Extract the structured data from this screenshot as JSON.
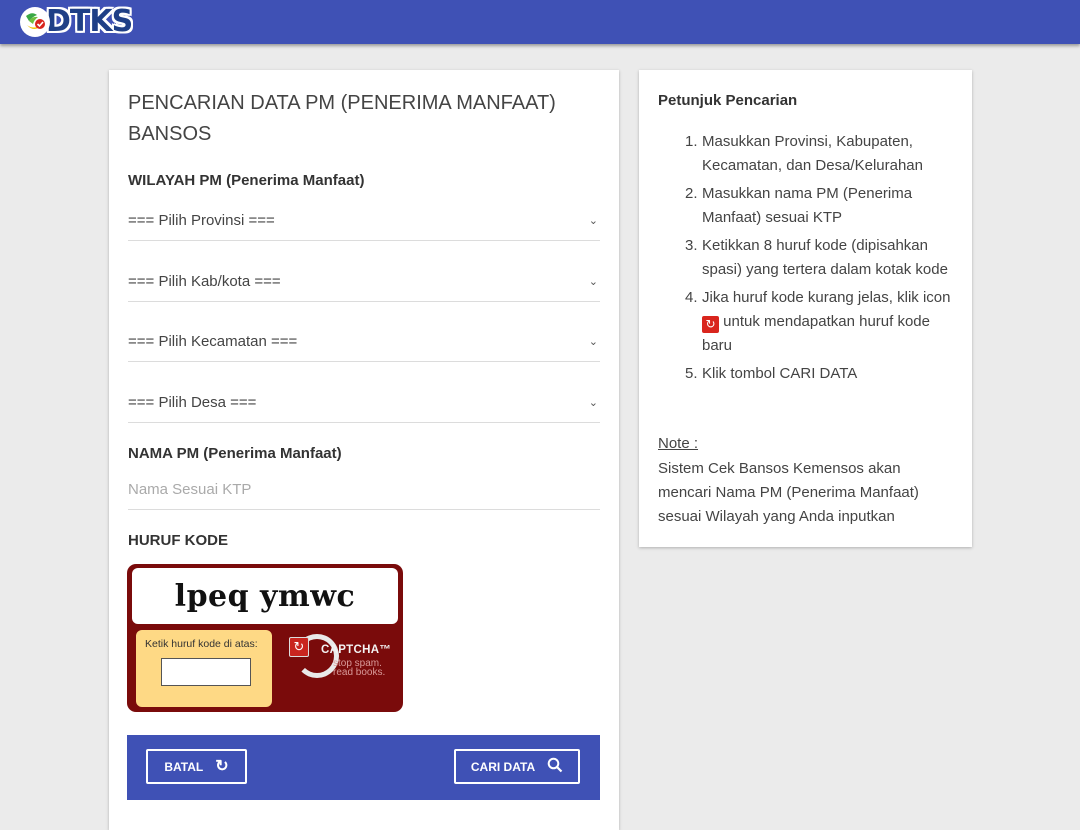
{
  "header": {
    "logo_text": "DTKS",
    "bar_color": "#3f51b5"
  },
  "form": {
    "title": "PENCARIAN DATA PM (PENERIMA MANFAAT) BANSOS",
    "region_label": "WILAYAH PM (Penerima Manfaat)",
    "selects": [
      {
        "label": "=== Pilih Provinsi ===",
        "icon": "chevron-down-icon"
      },
      {
        "label": "=== Pilih Kab/kota ===",
        "icon": "chevron-down-icon"
      },
      {
        "label": "=== Pilih Kecamatan ===",
        "icon": "chevron-down-icon"
      },
      {
        "label": "=== Pilih Desa ===",
        "icon": "chevron-down-icon"
      }
    ],
    "name_label": "NAMA PM (Penerima Manfaat)",
    "name_placeholder": "Nama Sesuai KTP",
    "name_value": "",
    "code_label": "HURUF KODE",
    "captcha": {
      "challenge": "lpeq ymwc",
      "entry_label": "Ketik huruf kode di atas:",
      "entry_value": "",
      "brand": "CAPTCHA™",
      "tagline_1": "stop spam.",
      "tagline_2": "read books."
    },
    "buttons": {
      "cancel": "BATAL",
      "search": "CARI DATA"
    }
  },
  "help": {
    "title": "Petunjuk Pencarian",
    "steps": [
      {
        "num": "1.",
        "text": "Masukkan Provinsi, Kabupaten, Kecamatan, dan Desa/Kelurahan"
      },
      {
        "num": "2.",
        "text": "Masukkan nama PM (Penerima Manfaat) sesuai KTP"
      },
      {
        "num": "3.",
        "text": "Ketikkan 8 huruf kode (dipisahkan spasi) yang tertera dalam kotak kode"
      },
      {
        "num": "4.",
        "text_before": "Jika huruf kode kurang jelas, klik icon",
        "text_after": "untuk mendapatkan huruf kode baru"
      },
      {
        "num": "5.",
        "text": "Klik tombol CARI DATA"
      }
    ],
    "note_title": "Note :",
    "note_text": "Sistem Cek Bansos Kemensos akan mencari Nama PM (Penerima Manfaat) sesuai Wilayah yang Anda inputkan"
  }
}
